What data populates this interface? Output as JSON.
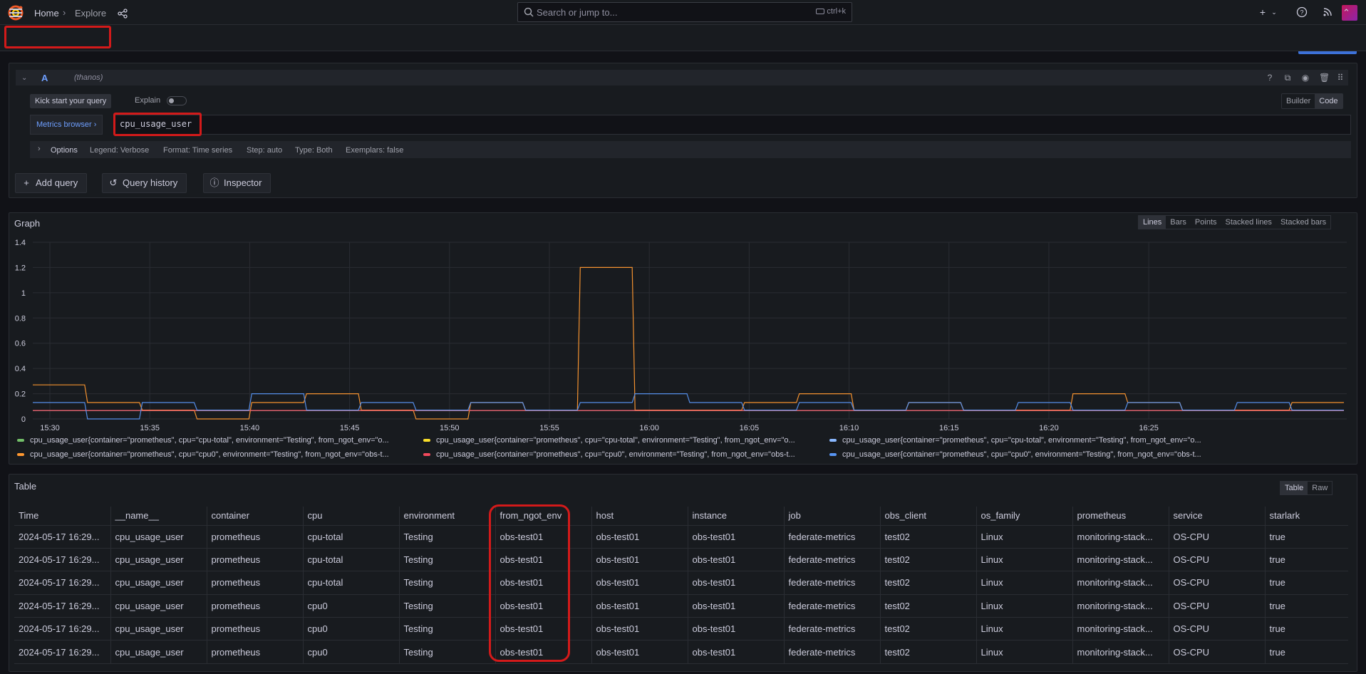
{
  "topbar": {
    "search_placeholder": "Search or jump to...",
    "search_shortcut": "ctrl+k",
    "add_label": "+"
  },
  "breadcrumb": {
    "home": "Home",
    "separator": "›",
    "current": "Explore"
  },
  "query": {
    "letter": "A",
    "datasource": "(thanos)",
    "kick_start": "Kick start your query",
    "explain_label": "Explain",
    "mode_builder": "Builder",
    "mode_code": "Code",
    "metrics_browser": "Metrics browser",
    "expression": "cpu_usage_user",
    "options_label": "Options",
    "options": [
      "Legend: Verbose",
      "Format: Time series",
      "Step: auto",
      "Type: Both",
      "Exemplars: false"
    ]
  },
  "actions": {
    "add_query": "Add query",
    "query_history": "Query history",
    "inspector": "Inspector"
  },
  "graph": {
    "title": "Graph",
    "modes": [
      "Lines",
      "Bars",
      "Points",
      "Stacked lines",
      "Stacked bars"
    ],
    "active_mode": "Lines"
  },
  "chart_data": {
    "type": "line",
    "title": "Graph",
    "xlabel": "",
    "ylabel": "",
    "ylim": [
      0,
      1.4
    ],
    "yticks": [
      "0",
      "0.2",
      "0.4",
      "0.6",
      "0.8",
      "1",
      "1.2",
      "1.4"
    ],
    "xticks": [
      "15:30",
      "15:35",
      "15:40",
      "15:45",
      "15:50",
      "15:55",
      "16:00",
      "16:05",
      "16:10",
      "16:15",
      "16:20",
      "16:25"
    ],
    "grid": true,
    "legend_position": "bottom",
    "series": [
      {
        "name": "cpu_usage_user{container=\"prometheus\", cpu=\"cpu-total\", environment=\"Testing\", from_ngot_env=\"o...",
        "color": "#73bf69",
        "values": [
          0.067,
          0.067,
          0.067,
          0.067,
          0.067,
          0.067,
          0.067,
          0.067,
          0.067,
          0.067,
          0.067,
          0.067
        ]
      },
      {
        "name": "cpu_usage_user{container=\"prometheus\", cpu=\"cpu-total\", environment=\"Testing\", from_ngot_env=\"o...",
        "color": "#fade2a",
        "values": [
          0.067,
          0.067,
          0.067,
          0.067,
          0.067,
          0.067,
          0.067,
          0.067,
          0.067,
          0.067,
          0.067,
          0.067
        ]
      },
      {
        "name": "cpu_usage_user{container=\"prometheus\", cpu=\"cpu-total\", environment=\"Testing\", from_ngot_env=\"o...",
        "color": "#8ab8ff",
        "values": [
          0.067,
          0.067,
          0.067,
          0.067,
          0.067,
          0.067,
          0.067,
          0.067,
          0.067,
          0.067,
          0.067,
          0.067
        ]
      },
      {
        "name": "cpu_usage_user{container=\"prometheus\", cpu=\"cpu0\", environment=\"Testing\", from_ngot_env=\"obs-t...",
        "color": "#ff9830",
        "values": [
          0.27,
          0.13,
          0.07,
          0.0,
          0.13,
          0.2,
          0.07,
          0.0,
          0.13,
          0.07,
          1.2,
          0.07,
          0.07,
          0.13,
          0.2,
          0.07,
          0.13,
          0.07,
          0.07,
          0.2,
          0.13,
          0.07,
          0.07,
          0.13
        ]
      },
      {
        "name": "cpu_usage_user{container=\"prometheus\", cpu=\"cpu0\", environment=\"Testing\", from_ngot_env=\"obs-t...",
        "color": "#f2495c",
        "values": [
          0.067,
          0.067,
          0.067,
          0.067,
          0.067,
          0.067,
          0.067,
          0.067,
          0.067,
          0.067,
          0.067,
          0.067
        ]
      },
      {
        "name": "cpu_usage_user{container=\"prometheus\", cpu=\"cpu0\", environment=\"Testing\", from_ngot_env=\"obs-t...",
        "color": "#5794f2",
        "values": [
          0.13,
          0.0,
          0.13,
          0.07,
          0.2,
          0.07,
          0.13,
          0.07,
          0.13,
          0.07,
          0.13,
          0.2,
          0.13,
          0.07,
          0.13,
          0.07,
          0.13,
          0.07,
          0.13,
          0.07,
          0.13,
          0.07,
          0.13,
          0.07
        ]
      }
    ]
  },
  "table": {
    "title": "Table",
    "modes": [
      "Table",
      "Raw"
    ],
    "columns": [
      "Time",
      "__name__",
      "container",
      "cpu",
      "environment",
      "from_ngot_env",
      "host",
      "instance",
      "job",
      "obs_client",
      "os_family",
      "prometheus",
      "service",
      "starlark"
    ],
    "rows": [
      [
        "2024-05-17 16:29...",
        "cpu_usage_user",
        "prometheus",
        "cpu-total",
        "Testing",
        "obs-test01",
        "obs-test01",
        "obs-test01",
        "federate-metrics",
        "test02",
        "Linux",
        "monitoring-stack...",
        "OS-CPU",
        "true"
      ],
      [
        "2024-05-17 16:29...",
        "cpu_usage_user",
        "prometheus",
        "cpu-total",
        "Testing",
        "obs-test01",
        "obs-test01",
        "obs-test01",
        "federate-metrics",
        "test02",
        "Linux",
        "monitoring-stack...",
        "OS-CPU",
        "true"
      ],
      [
        "2024-05-17 16:29...",
        "cpu_usage_user",
        "prometheus",
        "cpu-total",
        "Testing",
        "obs-test01",
        "obs-test01",
        "obs-test01",
        "federate-metrics",
        "test02",
        "Linux",
        "monitoring-stack...",
        "OS-CPU",
        "true"
      ],
      [
        "2024-05-17 16:29...",
        "cpu_usage_user",
        "prometheus",
        "cpu0",
        "Testing",
        "obs-test01",
        "obs-test01",
        "obs-test01",
        "federate-metrics",
        "test02",
        "Linux",
        "monitoring-stack...",
        "OS-CPU",
        "true"
      ],
      [
        "2024-05-17 16:29...",
        "cpu_usage_user",
        "prometheus",
        "cpu0",
        "Testing",
        "obs-test01",
        "obs-test01",
        "obs-test01",
        "federate-metrics",
        "test02",
        "Linux",
        "monitoring-stack...",
        "OS-CPU",
        "true"
      ],
      [
        "2024-05-17 16:29...",
        "cpu_usage_user",
        "prometheus",
        "cpu0",
        "Testing",
        "obs-test01",
        "obs-test01",
        "obs-test01",
        "federate-metrics",
        "test02",
        "Linux",
        "monitoring-stack...",
        "OS-CPU",
        "true"
      ]
    ]
  },
  "colors": {
    "accent": "#6e9fff",
    "highlight": "#d31a1a",
    "background": "#111217",
    "panel": "#181b1f"
  }
}
